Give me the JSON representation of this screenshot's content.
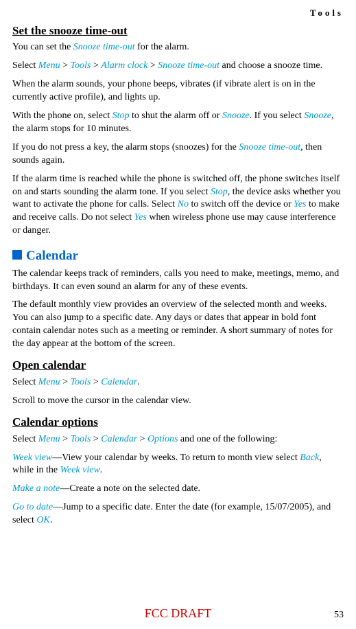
{
  "header": {
    "section": "Tools"
  },
  "h_snooze": "Set the snooze time-out",
  "p1_a": "You can set the ",
  "p1_b": "Snooze time-out",
  "p1_c": " for the alarm.",
  "p2_a": "Select ",
  "p2_menu": "Menu",
  "p2_gt1": " > ",
  "p2_tools": "Tools",
  "p2_gt2": " > ",
  "p2_alarm": "Alarm clock",
  "p2_gt3": " > ",
  "p2_snooze": "Snooze time-out",
  "p2_end": " and choose a snooze time.",
  "p3": "When the alarm sounds, your phone beeps, vibrates (if vibrate alert is on in the currently active profile), and lights up.",
  "p4_a": "With the phone on, select ",
  "p4_stop": "Stop",
  "p4_b": " to shut the alarm off or ",
  "p4_snooze": "Snooze",
  "p4_c": ". If you select ",
  "p4_snooze2": "Snooze",
  "p4_d": ", the alarm stops for 10 minutes.",
  "p5_a": "If you do not press a key, the alarm stops (snoozes) for the ",
  "p5_snooze": "Snooze time-out",
  "p5_b": ", then sounds again.",
  "p6_a": "If the alarm time is reached while the phone is switched off, the phone switches itself on and starts sounding the alarm tone. If you select ",
  "p6_stop": "Stop",
  "p6_b": ", the device asks whether you want to activate the phone for calls. Select ",
  "p6_no": "No",
  "p6_c": " to switch off the device or ",
  "p6_yes": "Yes",
  "p6_d": " to make and receive calls. Do not select ",
  "p6_yes2": "Yes",
  "p6_e": " when wireless phone use may cause interference or danger.",
  "sec_calendar": "Calendar",
  "p7": "The calendar keeps track of reminders, calls you need to make, meetings, memo, and birthdays. It can even sound an alarm for any of these events.",
  "p8": "The default monthly view provides an overview of the selected month and weeks. You can also jump to a specific date. Any days or dates that appear in bold font contain calendar notes such as a meeting or reminder. A short summary of notes for the day appear at the bottom of the screen.",
  "h_open": "Open calendar",
  "p9_a": "Select ",
  "p9_menu": "Menu",
  "p9_gt1": " > ",
  "p9_tools": "Tools",
  "p9_gt2": " > ",
  "p9_cal": "Calendar",
  "p9_end": ".",
  "p10": "Scroll to move the cursor in the calendar view.",
  "h_calopt": "Calendar options",
  "p11_a": "Select ",
  "p11_menu": "Menu",
  "p11_gt1": " > ",
  "p11_tools": "Tools",
  "p11_gt2": " > ",
  "p11_cal": "Calendar",
  "p11_gt3": " > ",
  "p11_opt": "Options",
  "p11_end": " and one of the following:",
  "p12_week": "Week view",
  "p12_a": "—View your calendar by weeks. To return to month view select ",
  "p12_back": "Back",
  "p12_b": ", while in the ",
  "p12_week2": "Week view",
  "p12_c": ".",
  "p13_make": "Make a note",
  "p13_a": "—Create a note on the selected date.",
  "p14_goto": "Go to date",
  "p14_a": "—Jump to a specific date. Enter the date (for example, 15/07/2005), and select ",
  "p14_ok": "OK",
  "p14_b": ".",
  "footer": {
    "draft": "FCC DRAFT",
    "page": "53"
  }
}
